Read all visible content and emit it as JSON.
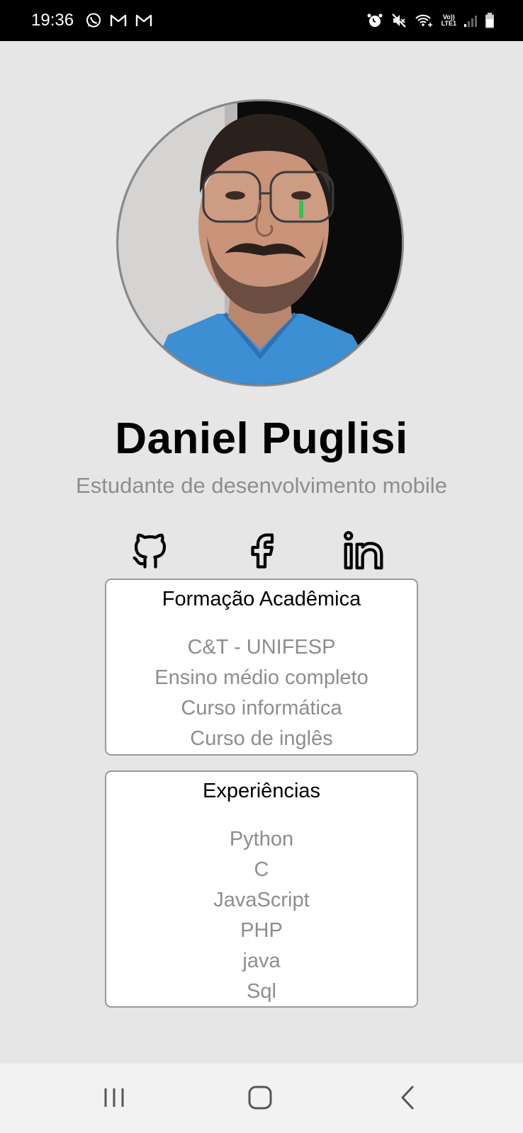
{
  "status_bar": {
    "time": "19:36",
    "left_icons": [
      "whatsapp-icon",
      "gmail-icon",
      "gmail-icon"
    ],
    "right_icons": [
      "alarm-icon",
      "mute-icon",
      "wifi-calling-icon",
      "volte-lte-icon",
      "signal-icon",
      "battery-icon"
    ],
    "network_label_top": "Vo))",
    "network_label_bottom": "LTE1"
  },
  "profile": {
    "name": "Daniel Puglisi",
    "subtitle": "Estudante de desenvolvimento mobile"
  },
  "social_links": [
    {
      "icon": "github-icon"
    },
    {
      "icon": "facebook-icon"
    },
    {
      "icon": "linkedin-icon"
    }
  ],
  "education": {
    "title": "Formação Acadêmica",
    "items": [
      "C&T - UNIFESP",
      "Ensino médio completo",
      "Curso informática",
      "Curso de inglês"
    ]
  },
  "experience": {
    "title": "Experiências",
    "items": [
      "Python",
      "C",
      "JavaScript",
      "PHP",
      "java",
      "Sql"
    ]
  },
  "nav_bar": {
    "buttons": [
      "recent-apps-icon",
      "home-icon",
      "back-icon"
    ]
  },
  "colors": {
    "background": "#e6e6e6",
    "muted_text": "#8e8e8e",
    "card_border": "#9a9a9a"
  }
}
